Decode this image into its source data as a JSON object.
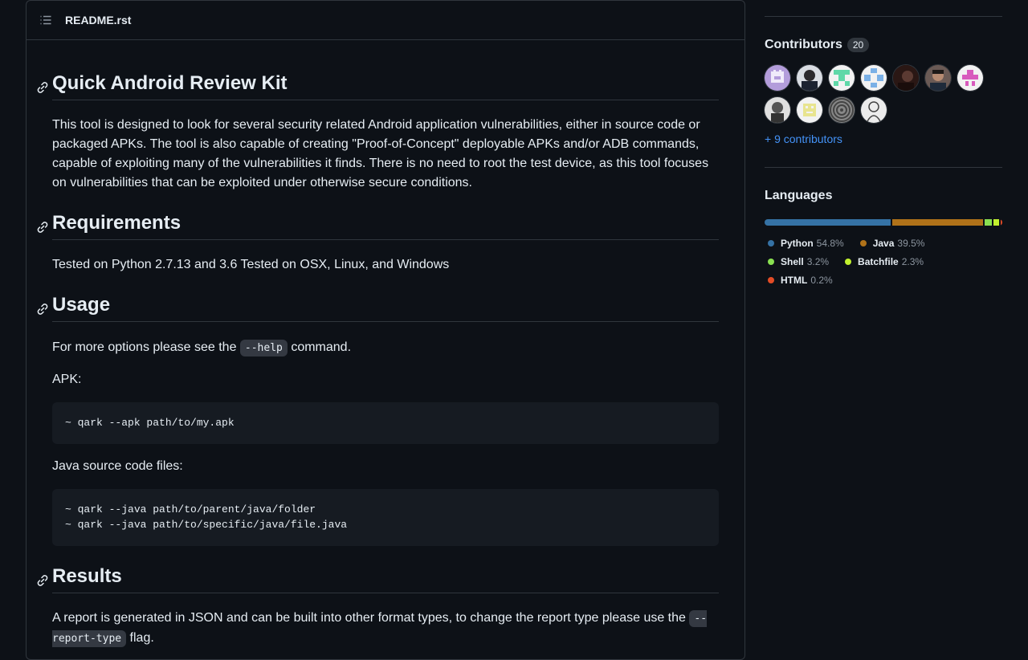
{
  "readme": {
    "filename": "README.rst",
    "sections": {
      "title": "Quick Android Review Kit",
      "intro": "This tool is designed to look for several security related Android application vulnerabilities, either in source code or packaged APKs. The tool is also capable of creating \"Proof-of-Concept\" deployable APKs and/or ADB commands, capable of exploiting many of the vulnerabilities it finds. There is no need to root the test device, as this tool focuses on vulnerabilities that can be exploited under otherwise secure conditions.",
      "requirements_heading": "Requirements",
      "requirements_text": "Tested on Python 2.7.13 and 3.6 Tested on OSX, Linux, and Windows",
      "usage_heading": "Usage",
      "usage_pre": "For more options please see the ",
      "usage_code": "--help",
      "usage_post": " command.",
      "apk_label": "APK:",
      "apk_code": "~ qark --apk path/to/my.apk",
      "java_label": "Java source code files:",
      "java_code": "~ qark --java path/to/parent/java/folder\n~ qark --java path/to/specific/java/file.java",
      "results_heading": "Results",
      "results_pre": "A report is generated in JSON and can be built into other format types, to change the report type please use the ",
      "results_code": "--report-type",
      "results_post": " flag."
    }
  },
  "contributors": {
    "title": "Contributors",
    "count": "20",
    "more_link": "+ 9 contributors",
    "avatars": [
      "avatar-1",
      "avatar-2",
      "avatar-3",
      "avatar-4",
      "avatar-5",
      "avatar-6",
      "avatar-7",
      "avatar-8",
      "avatar-9",
      "avatar-10",
      "avatar-11"
    ]
  },
  "languages": {
    "title": "Languages",
    "items": [
      {
        "name": "Python",
        "percent": "54.8%",
        "value": 54.8,
        "color": "#3572A5"
      },
      {
        "name": "Java",
        "percent": "39.5%",
        "value": 39.5,
        "color": "#b07219"
      },
      {
        "name": "Shell",
        "percent": "3.2%",
        "value": 3.2,
        "color": "#89e051"
      },
      {
        "name": "Batchfile",
        "percent": "2.3%",
        "value": 2.3,
        "color": "#C1F12E"
      },
      {
        "name": "HTML",
        "percent": "0.2%",
        "value": 0.2,
        "color": "#e34c26"
      }
    ]
  }
}
